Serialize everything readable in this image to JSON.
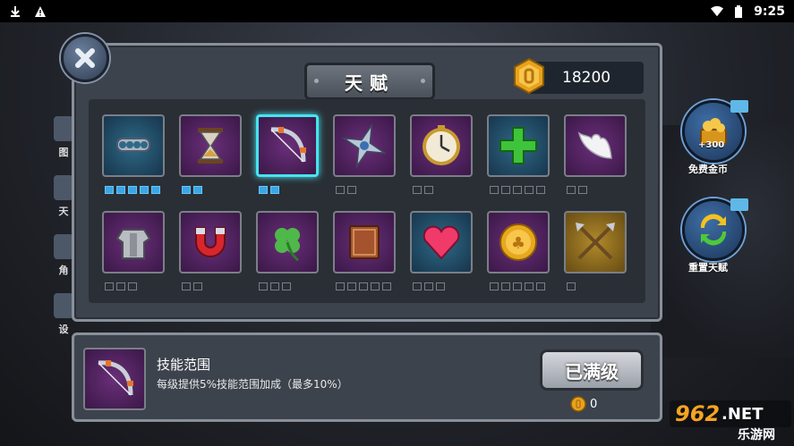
{
  "status_bar": {
    "time": "9:25",
    "icons": [
      "download-icon",
      "warning-icon",
      "wifi-icon",
      "battery-icon"
    ]
  },
  "side_menu": [
    "图",
    "天",
    "角",
    "设"
  ],
  "panel": {
    "title": "天赋",
    "coins": "18200"
  },
  "talents": [
    {
      "icon": "brass-knuckles-icon",
      "bg": "blue",
      "max": 5,
      "level": 5
    },
    {
      "icon": "hourglass-icon",
      "bg": "purple",
      "max": 2,
      "level": 2
    },
    {
      "icon": "bow-icon",
      "bg": "purple",
      "max": 2,
      "level": 2,
      "selected": true
    },
    {
      "icon": "shuriken-icon",
      "bg": "purple",
      "max": 2,
      "level": 0
    },
    {
      "icon": "clock-icon",
      "bg": "purple",
      "max": 2,
      "level": 0
    },
    {
      "icon": "green-cross-icon",
      "bg": "blue",
      "max": 5,
      "level": 0
    },
    {
      "icon": "wings-icon",
      "bg": "purple",
      "max": 2,
      "level": 0
    },
    {
      "icon": "armor-icon",
      "bg": "purple",
      "max": 3,
      "level": 0
    },
    {
      "icon": "magnet-icon",
      "bg": "purple",
      "max": 2,
      "level": 0
    },
    {
      "icon": "clover-icon",
      "bg": "purple",
      "max": 3,
      "level": 0
    },
    {
      "icon": "book-icon",
      "bg": "purple",
      "max": 5,
      "level": 0
    },
    {
      "icon": "heart-icon",
      "bg": "blue",
      "max": 3,
      "level": 0
    },
    {
      "icon": "gold-coin-icon",
      "bg": "purple",
      "max": 5,
      "level": 0
    },
    {
      "icon": "crossed-arrows-icon",
      "bg": "gold",
      "max": 1,
      "level": 0
    }
  ],
  "right_buttons": {
    "free_coins": {
      "label": "免费金币",
      "amount": "+300"
    },
    "reset": {
      "label": "重置天赋"
    }
  },
  "detail": {
    "name": "技能范围",
    "description": "每级提供5%技能范围加成（最多10%）",
    "button": "已满级",
    "cost": "0"
  },
  "watermark": {
    "text1": "962",
    "text2": ".NET",
    "text3": "乐游网"
  }
}
